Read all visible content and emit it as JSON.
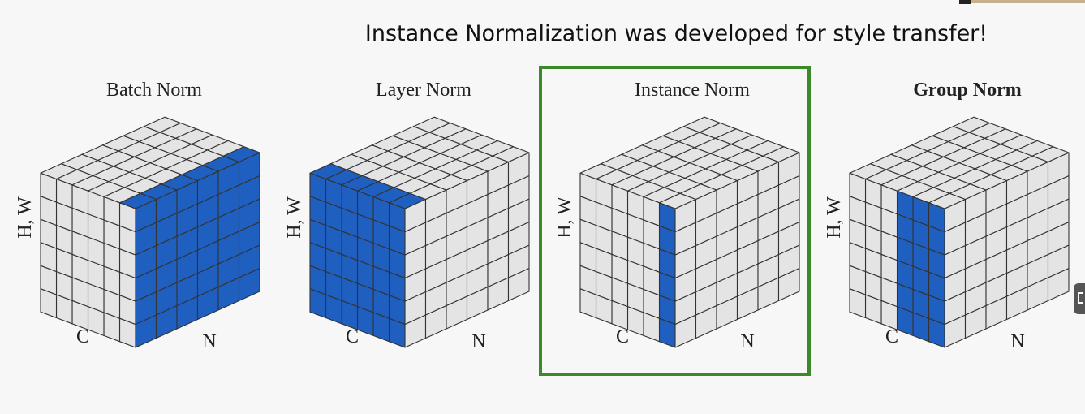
{
  "headline": "Instance Normalization was developed for style transfer!",
  "colors": {
    "highlight": "#1f5fbf",
    "cell": "#e4e4e4",
    "grid_line": "#333333",
    "frame": "#3a8a2a",
    "background": "#f7f7f7"
  },
  "panels": [
    {
      "title": "Batch Norm",
      "title_bold": false,
      "axis_hw": "H, W",
      "axis_c": "C",
      "axis_n": "N",
      "highlight": "batch",
      "framed": false
    },
    {
      "title": "Layer Norm",
      "title_bold": false,
      "axis_hw": "H, W",
      "axis_c": "C",
      "axis_n": "N",
      "highlight": "layer",
      "framed": false
    },
    {
      "title": "Instance Norm",
      "title_bold": false,
      "axis_hw": "H, W",
      "axis_c": "C",
      "axis_n": "N",
      "highlight": "instance",
      "framed": true
    },
    {
      "title": "Group Norm",
      "title_bold": true,
      "axis_hw": "H, W",
      "axis_c": "C",
      "axis_n": "N",
      "highlight": "group",
      "framed": false
    }
  ]
}
